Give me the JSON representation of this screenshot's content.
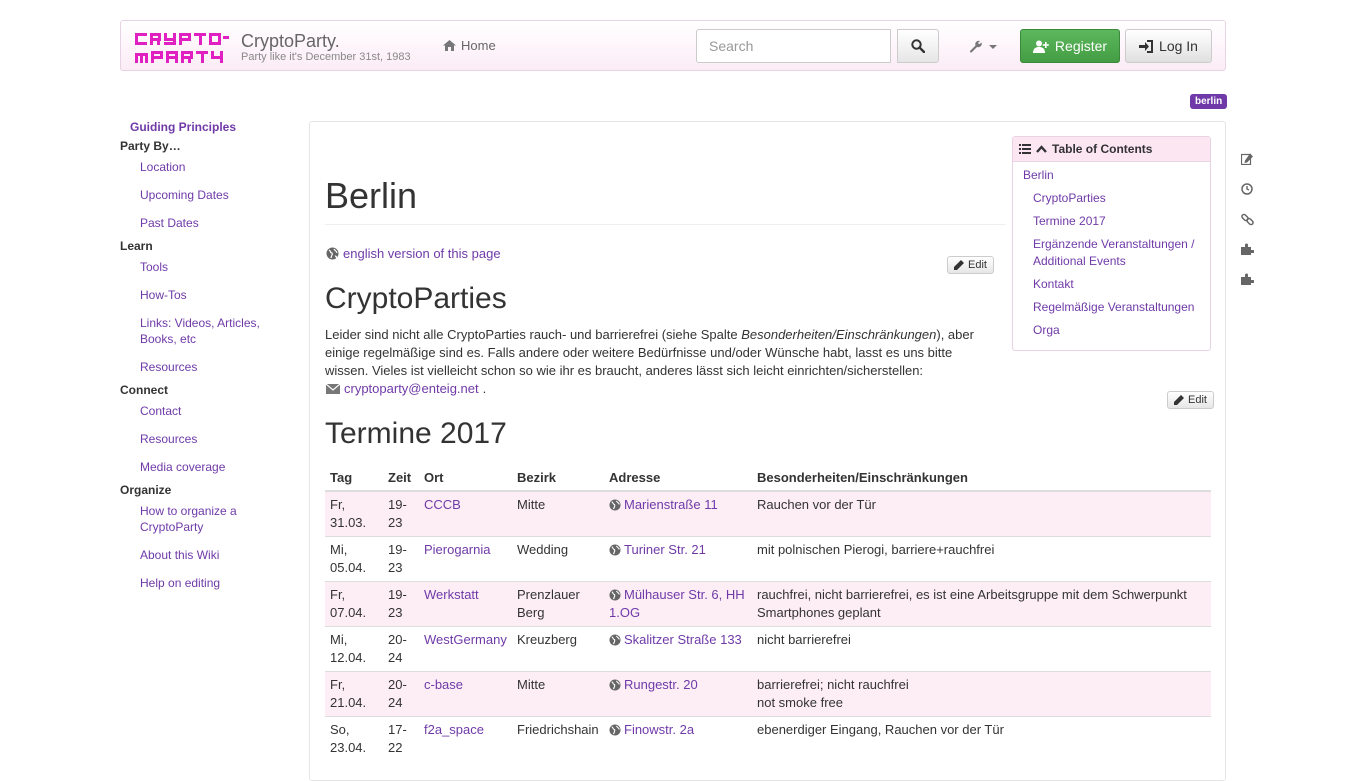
{
  "navbar": {
    "logo_text": "CRYPTO PARTY",
    "brand_title": "CryptoParty.",
    "brand_tagline": "Party like it's December 31st, 1983",
    "home_label": "Home",
    "search_placeholder": "Search",
    "register_label": "Register",
    "login_label": "Log In"
  },
  "category_badge": "berlin",
  "sidebar": {
    "guiding": "Guiding Principles",
    "sections": [
      {
        "heading": "Party By…",
        "items": [
          "Location",
          "Upcoming Dates",
          "Past Dates"
        ]
      },
      {
        "heading": "Learn",
        "items": [
          "Tools",
          "How-Tos",
          "Links: Videos, Articles, Books, etc",
          "Resources"
        ]
      },
      {
        "heading": "Connect",
        "items": [
          "Contact",
          "Resources",
          "Media coverage"
        ]
      },
      {
        "heading": "Organize",
        "items": [
          "How to organize a CryptoParty",
          "About this Wiki",
          "Help on editing"
        ]
      }
    ]
  },
  "page": {
    "title": "Berlin",
    "lang_link": "english version of this page",
    "edit_label": "Edit",
    "section1_title": "CryptoParties",
    "intro_text_1": "Leider sind nicht alle CryptoParties rauch- und barrierefrei (siehe Spalte ",
    "intro_text_em": "Besonderheiten/Einschränkungen",
    "intro_text_2": "), aber einige regelmäßige sind es. Falls andere oder weitere Bedürfnisse und/oder Wünsche habt, lasst es uns bitte wissen. Vieles ist vielleicht schon so wie ihr es braucht, anderes lässt sich leicht einrichten/sicherstellen:",
    "email": "cryptoparty@enteig.net",
    "section2_title": "Termine 2017"
  },
  "toc": {
    "title": "Table of Contents",
    "items": [
      "Berlin",
      "CryptoParties",
      "Termine 2017",
      "Ergänzende Veranstaltungen / Additional Events",
      "Kontakt",
      "Regelmäßige Veranstaltungen",
      "Orga"
    ]
  },
  "rail_icons": [
    "edit-icon",
    "history-icon",
    "link-icon",
    "plugin-icon",
    "plugin-icon-2"
  ],
  "table": {
    "headers": [
      "Tag",
      "Zeit",
      "Ort",
      "Bezirk",
      "Adresse",
      "Besonderheiten/Einschränkungen"
    ],
    "rows": [
      {
        "tag": "Fr, 31.03.",
        "zeit": "19-23",
        "ort": "CCCB",
        "bezirk": "Mitte",
        "adresse": "Marienstraße 11",
        "info": "Rauchen vor der Tür"
      },
      {
        "tag": "Mi, 05.04.",
        "zeit": "19-23",
        "ort": "Pierogarnia",
        "bezirk": "Wedding",
        "adresse": "Turiner Str. 21",
        "info": "mit polnischen Pierogi, barriere+rauchfrei"
      },
      {
        "tag": "Fr, 07.04.",
        "zeit": "19-23",
        "ort": "Werkstatt",
        "bezirk": "Prenzlauer Berg",
        "adresse": "Mülhauser Str. 6, HH 1.OG",
        "info": "rauchfrei, nicht barrierefrei, es ist eine Arbeitsgruppe mit dem Schwerpunkt Smartphones geplant"
      },
      {
        "tag": "Mi, 12.04.",
        "zeit": "20-24",
        "ort": "WestGermany",
        "bezirk": "Kreuzberg",
        "adresse": "Skalitzer Straße 133",
        "info": "nicht barrierefrei"
      },
      {
        "tag": "Fr, 21.04.",
        "zeit": "20-24",
        "ort": "c-base",
        "bezirk": "Mitte",
        "adresse": "Rungestr. 20",
        "info": "barrierefrei; nicht rauchfrei",
        "info2": "not smoke free"
      },
      {
        "tag": "So, 23.04.",
        "zeit": "17-22",
        "ort": "f2a_space",
        "bezirk": "Friedrichshain",
        "adresse": "Finowstr. 2a",
        "info": "ebenerdiger Eingang, Rauchen vor der Tür"
      }
    ]
  },
  "colors": {
    "accent": "#6f3aa8",
    "logo": "#e020c0",
    "register": "#5cb85c",
    "row_tint": "#fdeef6"
  }
}
